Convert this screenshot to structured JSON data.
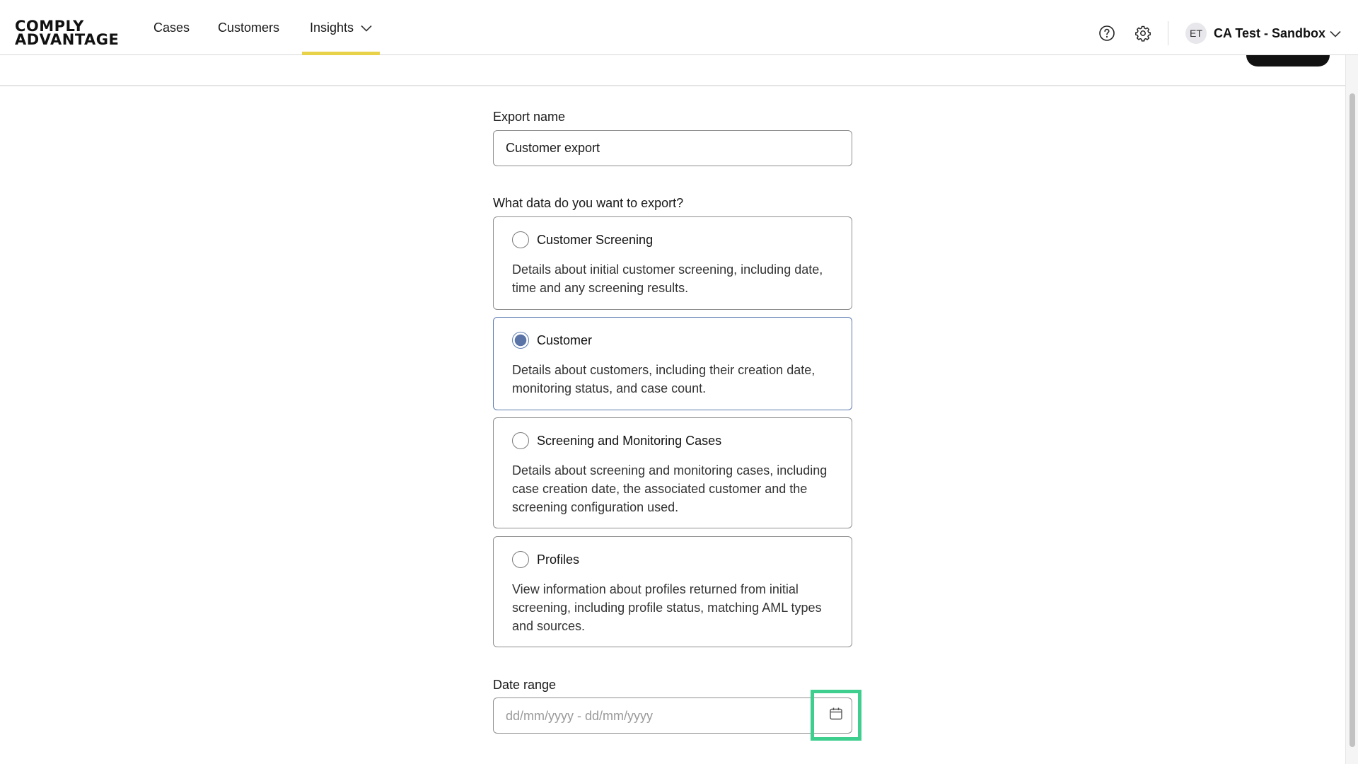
{
  "brand": {
    "line1": "COMPLY",
    "line2": "ADVANTAGE"
  },
  "nav": {
    "cases": "Cases",
    "customers": "Customers",
    "insights": "Insights",
    "accent_color": "#e8d24a"
  },
  "header": {
    "avatar_initials": "ET",
    "account_name": "CA Test - Sandbox"
  },
  "form": {
    "export_name_label": "Export name",
    "export_name_value": "Customer export",
    "data_question": "What data do you want to export?",
    "options": [
      {
        "title": "Customer Screening",
        "description": "Details about initial customer screening, including date, time and any screening results.",
        "selected": false
      },
      {
        "title": "Customer",
        "description": "Details about customers, including their creation date, monitoring status, and case count.",
        "selected": true
      },
      {
        "title": "Screening and Monitoring Cases",
        "description": "Details about screening and monitoring cases, including case creation date, the associated customer and the screening configuration used.",
        "selected": false
      },
      {
        "title": "Profiles",
        "description": "View information about profiles returned from initial screening, including profile status, matching AML types and sources.",
        "selected": false
      }
    ],
    "date_range_label": "Date range",
    "date_range_placeholder": "dd/mm/yyyy - dd/mm/yyyy",
    "selection_color": "#5b7bb0",
    "highlight_color": "#3ecf8e"
  },
  "icons": {
    "help": "help-circle-icon",
    "settings": "gear-icon",
    "account_dropdown": "chevron-down-icon",
    "insights_dropdown": "chevron-down-icon",
    "date_picker": "calendar-icon"
  }
}
